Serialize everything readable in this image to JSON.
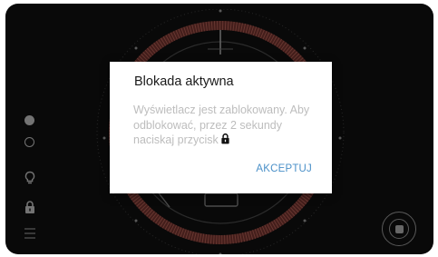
{
  "dialog": {
    "title": "Blokada aktywna",
    "message": "Wyświetlacz jest zablokowany. Aby odblokować, przez 2 sekundy naciskaj przycisk",
    "message_icon": "lock-icon",
    "accept_label": "AKCEPTUJ",
    "accept_color": "#4a90c8"
  },
  "sidebar": {
    "indicators": [
      "filled-dot",
      "hollow-dot"
    ],
    "icons": [
      "bulb-icon",
      "lock-icon",
      "menu-icon"
    ]
  },
  "colors": {
    "background": "#0d0d0d",
    "ring": "#6e2f2a",
    "icon_gray": "#9a9a9a"
  }
}
